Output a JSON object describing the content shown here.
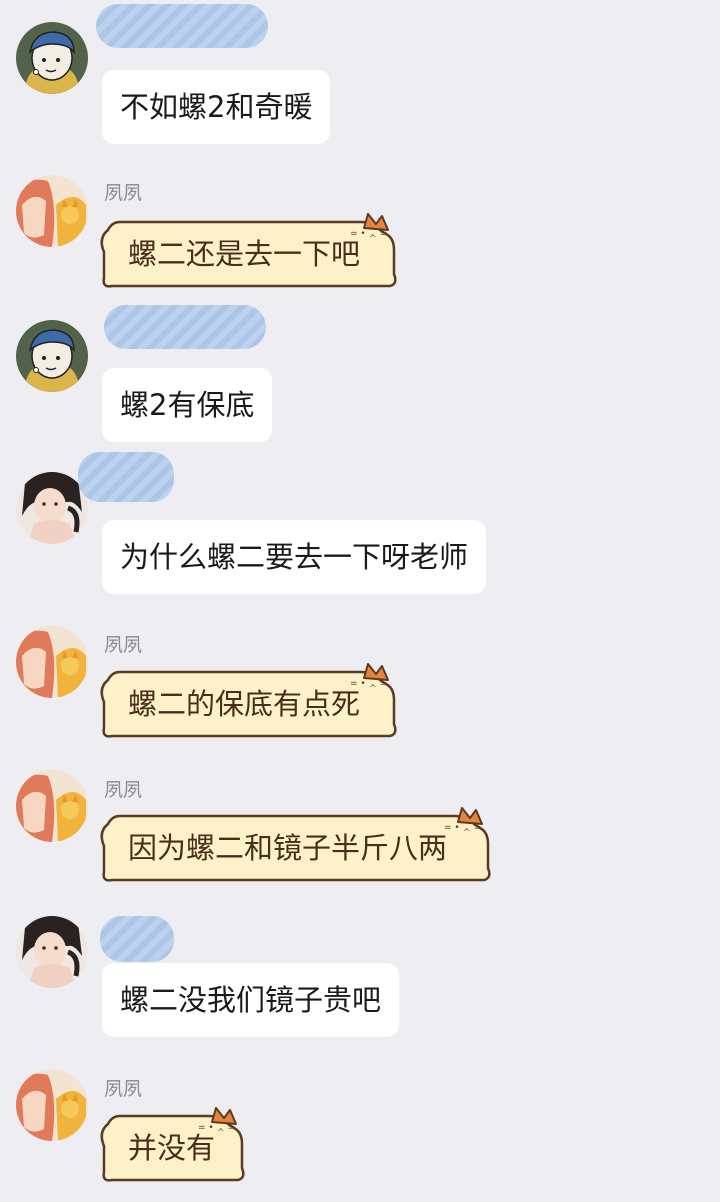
{
  "messages": [
    {
      "sender": "",
      "text": "不如螺2和奇暖"
    },
    {
      "sender": "夙夙",
      "text": "螺二还是去一下吧"
    },
    {
      "sender": "",
      "text": "螺2有保底"
    },
    {
      "sender": "",
      "text": "为什么螺二要去一下呀老师"
    },
    {
      "sender": "夙夙",
      "text": "螺二的保底有点死"
    },
    {
      "sender": "夙夙",
      "text": "因为螺二和镜子半斤八两"
    },
    {
      "sender": "",
      "text": "螺二没我们镜子贵吧"
    },
    {
      "sender": "夙夙",
      "text": "并没有"
    }
  ],
  "colors": {
    "background": "#ededf2",
    "bubble": "#ffffff",
    "cat_bubble_fill": "#fdf1c9",
    "cat_bubble_stroke": "#5a3a22",
    "redaction": "#a9c4e8"
  },
  "icons": {
    "avatar_a": "girl-with-pearl-earring-avatar",
    "avatar_b": "red-hair-anime-girl-avatar",
    "avatar_c": "photo-girl-avatar",
    "bubble_decoration": "cat-ears-icon"
  }
}
